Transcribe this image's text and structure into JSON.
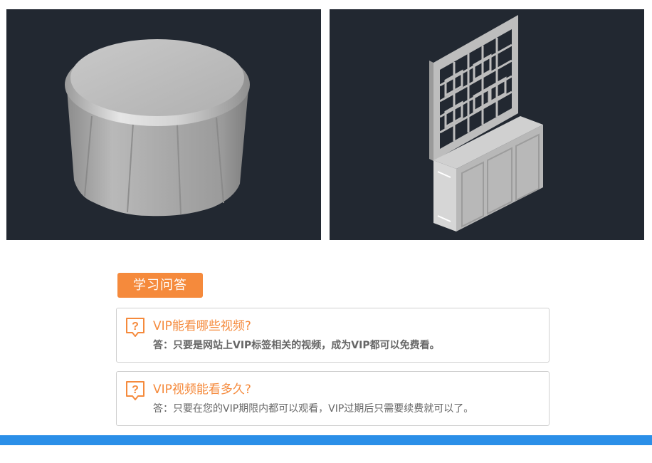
{
  "colors": {
    "viewport_bg": "#222831",
    "accent_orange": "#f58a3c",
    "bar_blue": "#2b8fe8",
    "model_gray": "#a8a8a8"
  },
  "viewports": [
    {
      "content": "round-tablecloth-3d-model"
    },
    {
      "content": "lattice-screen-cabinet-3d-model"
    }
  ],
  "qa_section": {
    "tab_label": "学习问答",
    "items": [
      {
        "question": "VIP能看哪些视频?",
        "answer": "答：只要是网站上VIP标签相关的视频，成为VIP都可以免费看。",
        "icon": "question-bubble-icon"
      },
      {
        "question": "VIP视频能看多久?",
        "answer": "答：只要在您的VIP期限内都可以观看，VIP过期后只需要续费就可以了。",
        "icon": "question-bubble-icon"
      }
    ]
  }
}
